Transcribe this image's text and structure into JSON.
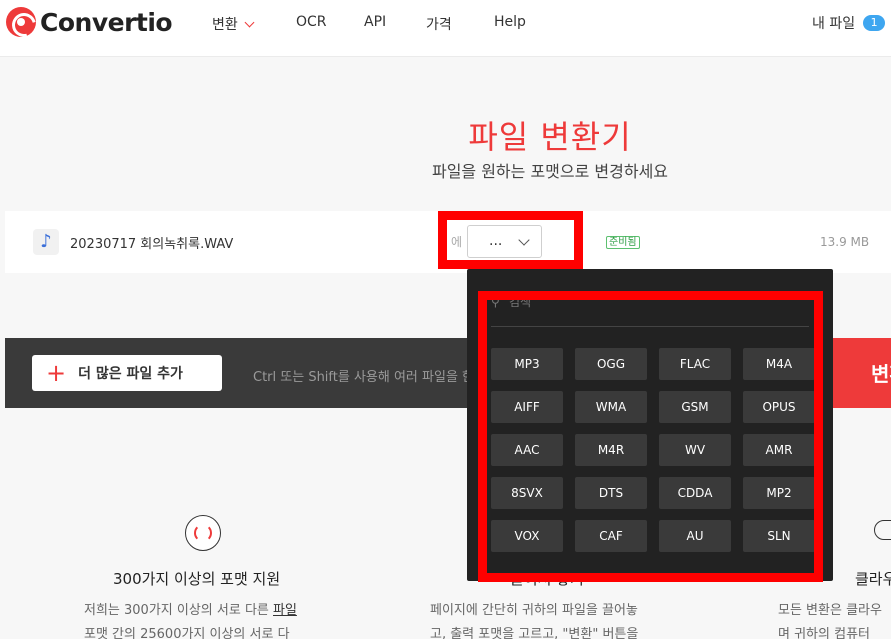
{
  "header": {
    "logo_text": "Convertio",
    "nav": [
      {
        "label": "변환",
        "has_dropdown": true
      },
      {
        "label": "OCR"
      },
      {
        "label": "API"
      },
      {
        "label": "가격"
      },
      {
        "label": "Help"
      }
    ],
    "my_files_label": "내 파일",
    "my_files_count": "1"
  },
  "hero": {
    "title": "파일 변환기",
    "subtitle": "파일을 원하는 포맷으로 변경하세요"
  },
  "file": {
    "icon": "music-note-icon",
    "name": "20230717 회의녹취록.WAV",
    "to_label": "에",
    "format_value": "...",
    "status": "준비됨",
    "size": "13.9 MB"
  },
  "actions": {
    "add_more_label": "더 많은 파일 추가",
    "hint": "Ctrl 또는 Shift를 사용해 여러 파일을 한",
    "convert_label": "변환"
  },
  "dropdown": {
    "search_placeholder": "검색",
    "formats": [
      "MP3",
      "OGG",
      "FLAC",
      "M4A",
      "AIFF",
      "WMA",
      "GSM",
      "OPUS",
      "AAC",
      "M4R",
      "WV",
      "AMR",
      "8SVX",
      "DTS",
      "CDDA",
      "MP2",
      "VOX",
      "CAF",
      "AU",
      "SLN"
    ]
  },
  "features": [
    {
      "title": "300가지 이상의 포맷 지원",
      "line1_pre": "저희는 300가지 이상의 서로 다른 ",
      "line1_link": "파일",
      "line2": "포맷 간의 25600가지 이상의 서로 다"
    },
    {
      "title": "끌어서 놓기",
      "line1": "페이지에 간단히 귀하의 파일을 끌어놓",
      "line2": "고, 출력 포맷을 고르고, \"변환\" 버튼을"
    },
    {
      "title": "클라우드",
      "line1": "모든 변환은 클라우",
      "line2": "며 귀하의 컴퓨터"
    }
  ],
  "colors": {
    "brand_red": "#ee3a3a",
    "badge_blue": "#3ea6f0",
    "dark_bar": "#3a3a3a",
    "highlight": "#ff0000"
  }
}
